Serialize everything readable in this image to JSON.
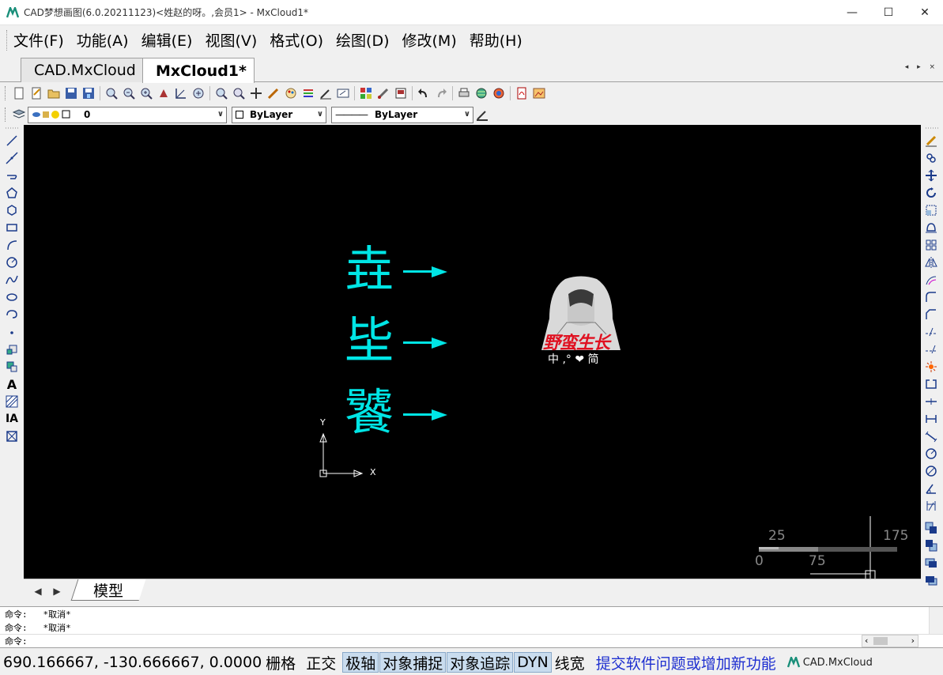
{
  "window": {
    "title": "CAD梦想画图(6.0.20211123)<姓赵的呀。,会员1> - MxCloud1*",
    "controls": {
      "minimize": "—",
      "maximize": "☐",
      "close": "✕"
    }
  },
  "menu": {
    "items": [
      {
        "label": "文件(F)"
      },
      {
        "label": "功能(A)"
      },
      {
        "label": "编辑(E)"
      },
      {
        "label": "视图(V)"
      },
      {
        "label": "格式(O)"
      },
      {
        "label": "绘图(D)"
      },
      {
        "label": "修改(M)"
      },
      {
        "label": "帮助(H)"
      }
    ]
  },
  "tabs": {
    "items": [
      {
        "label": "CAD.MxCloud"
      },
      {
        "label": "MxCloud1*"
      }
    ],
    "nav": "◂ ▸ ×"
  },
  "properties": {
    "layer": "0",
    "color": "ByLayer",
    "linetype": "ByLayer",
    "linetype_preview": "————"
  },
  "drawing": {
    "glyphs": [
      "垚",
      "坒",
      "饕"
    ],
    "watermark": {
      "title": "野蛮生长",
      "subtitle": "中 ,° ❤ 简"
    },
    "ucs": {
      "x_label": "X",
      "y_label": "Y"
    },
    "scale": {
      "ticks": [
        "25",
        "175",
        "0",
        "75"
      ]
    }
  },
  "model_tab": {
    "label": "模型"
  },
  "command": {
    "lines": [
      "命令:   *取消*",
      "命令:   *取消*"
    ],
    "prompt": "命令:"
  },
  "status": {
    "coords": "690.166667,  -130.666667,  0.0000",
    "toggles": [
      {
        "label": "栅格",
        "on": false
      },
      {
        "label": "正交",
        "on": false
      },
      {
        "label": "极轴",
        "on": true
      },
      {
        "label": "对象捕捉",
        "on": true
      },
      {
        "label": "对象追踪",
        "on": true
      },
      {
        "label": "DYN",
        "on": true
      },
      {
        "label": "线宽",
        "on": false
      }
    ],
    "link": "提交软件问题或增加新功能",
    "brand": "CAD.MxCloud"
  },
  "colors": {
    "canvas_bg": "#000000",
    "glyph": "#00e5e5",
    "status_on": "#c9dcee",
    "link": "#1e2fd0"
  }
}
